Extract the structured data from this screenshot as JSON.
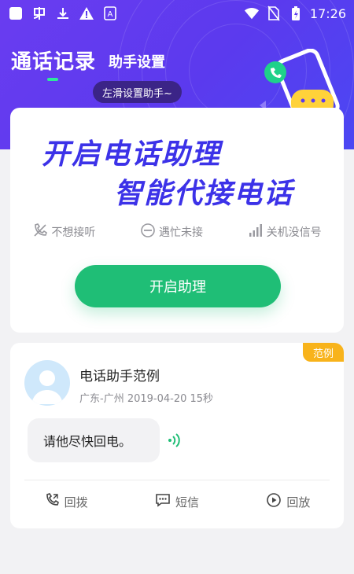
{
  "status_bar": {
    "time": "17:26",
    "icons": [
      "square-icon",
      "app-icon",
      "download-icon",
      "warning-icon",
      "a-box-icon",
      "wifi-icon",
      "no-sim-icon",
      "battery-charging-icon"
    ]
  },
  "tabs": [
    {
      "label": "通话记录",
      "active": true
    },
    {
      "label": "助手设置",
      "active": false
    }
  ],
  "tooltip": "左滑设置助手~",
  "promo": {
    "line1": "开启电话助理",
    "line2": "智能代接电话"
  },
  "features": [
    {
      "label": "不想接听",
      "icon": "no-call-icon"
    },
    {
      "label": "遇忙未接",
      "icon": "busy-icon"
    },
    {
      "label": "关机没信号",
      "icon": "signal-bars-icon"
    }
  ],
  "enable_button": "开启助理",
  "sample_card": {
    "badge": "范例",
    "caller_name": "电话助手范例",
    "meta": "广东-广州  2019-04-20  15秒",
    "message": "请他尽快回电。",
    "actions": [
      {
        "label": "回拨",
        "icon": "phone-callback-icon"
      },
      {
        "label": "短信",
        "icon": "message-icon"
      },
      {
        "label": "回放",
        "icon": "play-icon"
      }
    ]
  },
  "colors": {
    "header": "#5b3aee",
    "promo_text": "#3c32e8",
    "button": "#1fbe76",
    "badge": "#f8b31b",
    "tab_indicator": "#2ee89a"
  }
}
